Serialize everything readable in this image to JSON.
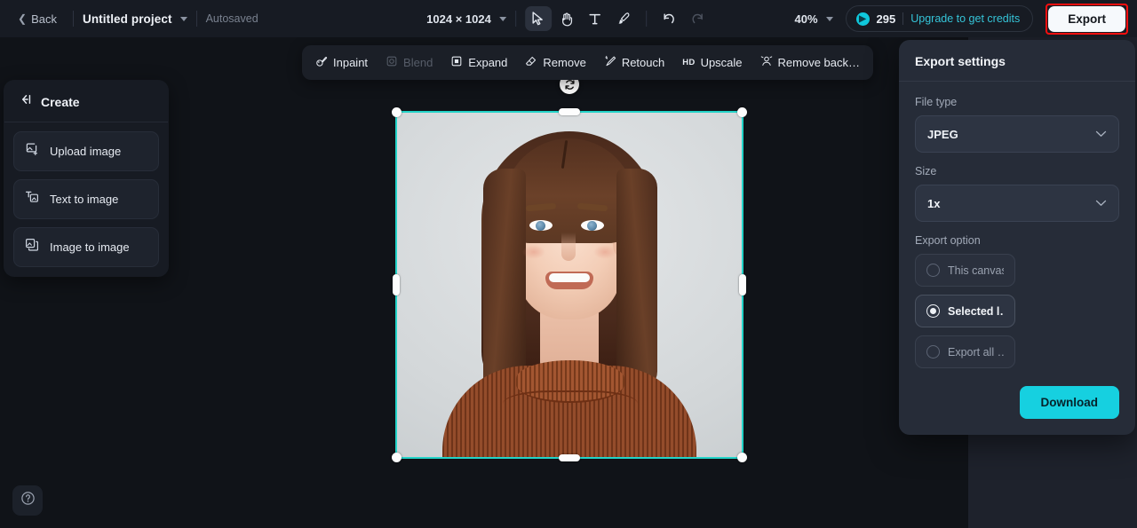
{
  "topbar": {
    "back_label": "Back",
    "project_name": "Untitled project",
    "autosaved_label": "Autosaved",
    "canvas_dimensions": "1024 × 1024",
    "tools": [
      {
        "name": "select-tool",
        "icon": "cursor-icon",
        "active": true
      },
      {
        "name": "hand-tool",
        "icon": "hand-icon",
        "active": false
      },
      {
        "name": "text-tool",
        "icon": "text-icon",
        "active": false
      },
      {
        "name": "brush-tool",
        "icon": "brush-icon",
        "active": false
      }
    ],
    "undo_label": "undo-icon",
    "redo_label": "redo-icon",
    "zoom_level": "40%",
    "credits_count": "295",
    "upgrade_label": "Upgrade to get credits",
    "export_label": "Export",
    "accent_cyan": "#35c4d8",
    "annotation_color": "#fb0f0f"
  },
  "create_panel": {
    "title": "Create",
    "collapse_icon": "collapse-left-icon",
    "items": [
      {
        "label": "Upload image",
        "icon": "upload-image-icon"
      },
      {
        "label": "Text to image",
        "icon": "text-to-image-icon"
      },
      {
        "label": "Image to image",
        "icon": "image-to-image-icon"
      }
    ]
  },
  "canvas_toolbar": {
    "items": [
      {
        "label": "Inpaint",
        "icon": "inpaint-icon",
        "disabled": false
      },
      {
        "label": "Blend",
        "icon": "blend-icon",
        "disabled": true
      },
      {
        "label": "Expand",
        "icon": "expand-icon",
        "disabled": false
      },
      {
        "label": "Remove",
        "icon": "remove-icon",
        "disabled": false
      },
      {
        "label": "Retouch",
        "icon": "retouch-icon",
        "disabled": false
      },
      {
        "label": "Upscale",
        "icon": "hd-icon",
        "badge": "HD",
        "disabled": false
      },
      {
        "label": "Remove back…",
        "icon": "remove-background-icon",
        "disabled": false
      }
    ]
  },
  "canvas": {
    "selection": {
      "rotate_icon": "rotate-icon",
      "selection_color": "#23d3c8"
    },
    "image_alt": "portrait-photo-woman-brown-turtleneck"
  },
  "export_panel": {
    "title": "Export settings",
    "file_type": {
      "label": "File type",
      "value": "JPEG"
    },
    "size": {
      "label": "Size",
      "value": "1x"
    },
    "export_option": {
      "label": "Export option",
      "options": [
        {
          "label": "This canvas",
          "selected": false
        },
        {
          "label": "Selected l…",
          "selected": true
        },
        {
          "label": "Export all …",
          "selected": false
        }
      ]
    },
    "download_label": "Download",
    "download_color": "#16d0e0"
  },
  "help": {
    "icon": "help-circle-icon"
  }
}
